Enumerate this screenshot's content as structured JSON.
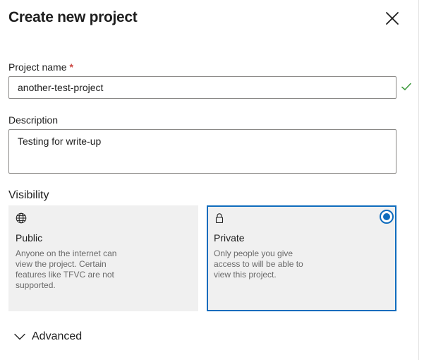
{
  "dialog": {
    "title": "Create new project",
    "close_icon": "close-icon"
  },
  "project_name": {
    "label": "Project name",
    "required_marker": "*",
    "value": "another-test-project",
    "valid_icon": "checkmark-icon"
  },
  "description": {
    "label": "Description",
    "value": "Testing for write-up"
  },
  "visibility": {
    "label": "Visibility",
    "options": [
      {
        "icon": "globe-icon",
        "title": "Public",
        "description": "Anyone on the internet can view the project. Certain features like TFVC are not supported.",
        "selected": false
      },
      {
        "icon": "lock-icon",
        "title": "Private",
        "description": "Only people you give access to will be able to view this project.",
        "selected": true
      }
    ]
  },
  "advanced": {
    "label": "Advanced",
    "icon": "chevron-down-icon",
    "expanded": false
  },
  "colors": {
    "accent": "#0f6cbd",
    "required": "#cd4a45",
    "valid": "#3f9b3f",
    "card_bg": "#f0f0f0"
  }
}
